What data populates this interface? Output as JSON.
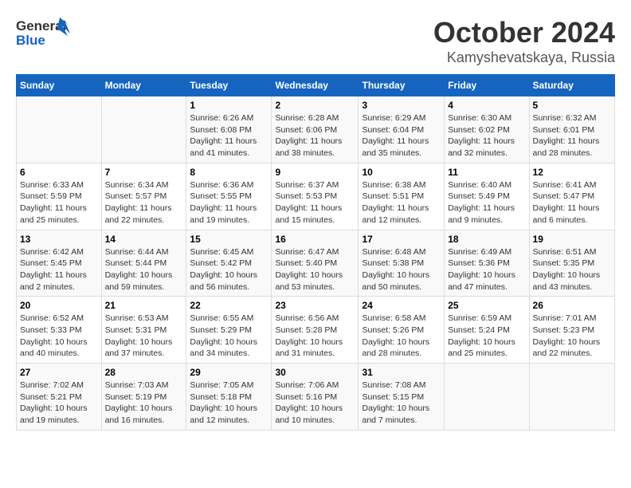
{
  "header": {
    "logo_line1": "General",
    "logo_line2": "Blue",
    "month": "October 2024",
    "location": "Kamyshevatskaya, Russia"
  },
  "weekdays": [
    "Sunday",
    "Monday",
    "Tuesday",
    "Wednesday",
    "Thursday",
    "Friday",
    "Saturday"
  ],
  "weeks": [
    [
      {
        "day": "",
        "sunrise": "",
        "sunset": "",
        "daylight": ""
      },
      {
        "day": "",
        "sunrise": "",
        "sunset": "",
        "daylight": ""
      },
      {
        "day": "1",
        "sunrise": "Sunrise: 6:26 AM",
        "sunset": "Sunset: 6:08 PM",
        "daylight": "Daylight: 11 hours and 41 minutes."
      },
      {
        "day": "2",
        "sunrise": "Sunrise: 6:28 AM",
        "sunset": "Sunset: 6:06 PM",
        "daylight": "Daylight: 11 hours and 38 minutes."
      },
      {
        "day": "3",
        "sunrise": "Sunrise: 6:29 AM",
        "sunset": "Sunset: 6:04 PM",
        "daylight": "Daylight: 11 hours and 35 minutes."
      },
      {
        "day": "4",
        "sunrise": "Sunrise: 6:30 AM",
        "sunset": "Sunset: 6:02 PM",
        "daylight": "Daylight: 11 hours and 32 minutes."
      },
      {
        "day": "5",
        "sunrise": "Sunrise: 6:32 AM",
        "sunset": "Sunset: 6:01 PM",
        "daylight": "Daylight: 11 hours and 28 minutes."
      }
    ],
    [
      {
        "day": "6",
        "sunrise": "Sunrise: 6:33 AM",
        "sunset": "Sunset: 5:59 PM",
        "daylight": "Daylight: 11 hours and 25 minutes."
      },
      {
        "day": "7",
        "sunrise": "Sunrise: 6:34 AM",
        "sunset": "Sunset: 5:57 PM",
        "daylight": "Daylight: 11 hours and 22 minutes."
      },
      {
        "day": "8",
        "sunrise": "Sunrise: 6:36 AM",
        "sunset": "Sunset: 5:55 PM",
        "daylight": "Daylight: 11 hours and 19 minutes."
      },
      {
        "day": "9",
        "sunrise": "Sunrise: 6:37 AM",
        "sunset": "Sunset: 5:53 PM",
        "daylight": "Daylight: 11 hours and 15 minutes."
      },
      {
        "day": "10",
        "sunrise": "Sunrise: 6:38 AM",
        "sunset": "Sunset: 5:51 PM",
        "daylight": "Daylight: 11 hours and 12 minutes."
      },
      {
        "day": "11",
        "sunrise": "Sunrise: 6:40 AM",
        "sunset": "Sunset: 5:49 PM",
        "daylight": "Daylight: 11 hours and 9 minutes."
      },
      {
        "day": "12",
        "sunrise": "Sunrise: 6:41 AM",
        "sunset": "Sunset: 5:47 PM",
        "daylight": "Daylight: 11 hours and 6 minutes."
      }
    ],
    [
      {
        "day": "13",
        "sunrise": "Sunrise: 6:42 AM",
        "sunset": "Sunset: 5:45 PM",
        "daylight": "Daylight: 11 hours and 2 minutes."
      },
      {
        "day": "14",
        "sunrise": "Sunrise: 6:44 AM",
        "sunset": "Sunset: 5:44 PM",
        "daylight": "Daylight: 10 hours and 59 minutes."
      },
      {
        "day": "15",
        "sunrise": "Sunrise: 6:45 AM",
        "sunset": "Sunset: 5:42 PM",
        "daylight": "Daylight: 10 hours and 56 minutes."
      },
      {
        "day": "16",
        "sunrise": "Sunrise: 6:47 AM",
        "sunset": "Sunset: 5:40 PM",
        "daylight": "Daylight: 10 hours and 53 minutes."
      },
      {
        "day": "17",
        "sunrise": "Sunrise: 6:48 AM",
        "sunset": "Sunset: 5:38 PM",
        "daylight": "Daylight: 10 hours and 50 minutes."
      },
      {
        "day": "18",
        "sunrise": "Sunrise: 6:49 AM",
        "sunset": "Sunset: 5:36 PM",
        "daylight": "Daylight: 10 hours and 47 minutes."
      },
      {
        "day": "19",
        "sunrise": "Sunrise: 6:51 AM",
        "sunset": "Sunset: 5:35 PM",
        "daylight": "Daylight: 10 hours and 43 minutes."
      }
    ],
    [
      {
        "day": "20",
        "sunrise": "Sunrise: 6:52 AM",
        "sunset": "Sunset: 5:33 PM",
        "daylight": "Daylight: 10 hours and 40 minutes."
      },
      {
        "day": "21",
        "sunrise": "Sunrise: 6:53 AM",
        "sunset": "Sunset: 5:31 PM",
        "daylight": "Daylight: 10 hours and 37 minutes."
      },
      {
        "day": "22",
        "sunrise": "Sunrise: 6:55 AM",
        "sunset": "Sunset: 5:29 PM",
        "daylight": "Daylight: 10 hours and 34 minutes."
      },
      {
        "day": "23",
        "sunrise": "Sunrise: 6:56 AM",
        "sunset": "Sunset: 5:28 PM",
        "daylight": "Daylight: 10 hours and 31 minutes."
      },
      {
        "day": "24",
        "sunrise": "Sunrise: 6:58 AM",
        "sunset": "Sunset: 5:26 PM",
        "daylight": "Daylight: 10 hours and 28 minutes."
      },
      {
        "day": "25",
        "sunrise": "Sunrise: 6:59 AM",
        "sunset": "Sunset: 5:24 PM",
        "daylight": "Daylight: 10 hours and 25 minutes."
      },
      {
        "day": "26",
        "sunrise": "Sunrise: 7:01 AM",
        "sunset": "Sunset: 5:23 PM",
        "daylight": "Daylight: 10 hours and 22 minutes."
      }
    ],
    [
      {
        "day": "27",
        "sunrise": "Sunrise: 7:02 AM",
        "sunset": "Sunset: 5:21 PM",
        "daylight": "Daylight: 10 hours and 19 minutes."
      },
      {
        "day": "28",
        "sunrise": "Sunrise: 7:03 AM",
        "sunset": "Sunset: 5:19 PM",
        "daylight": "Daylight: 10 hours and 16 minutes."
      },
      {
        "day": "29",
        "sunrise": "Sunrise: 7:05 AM",
        "sunset": "Sunset: 5:18 PM",
        "daylight": "Daylight: 10 hours and 12 minutes."
      },
      {
        "day": "30",
        "sunrise": "Sunrise: 7:06 AM",
        "sunset": "Sunset: 5:16 PM",
        "daylight": "Daylight: 10 hours and 10 minutes."
      },
      {
        "day": "31",
        "sunrise": "Sunrise: 7:08 AM",
        "sunset": "Sunset: 5:15 PM",
        "daylight": "Daylight: 10 hours and 7 minutes."
      },
      {
        "day": "",
        "sunrise": "",
        "sunset": "",
        "daylight": ""
      },
      {
        "day": "",
        "sunrise": "",
        "sunset": "",
        "daylight": ""
      }
    ]
  ]
}
